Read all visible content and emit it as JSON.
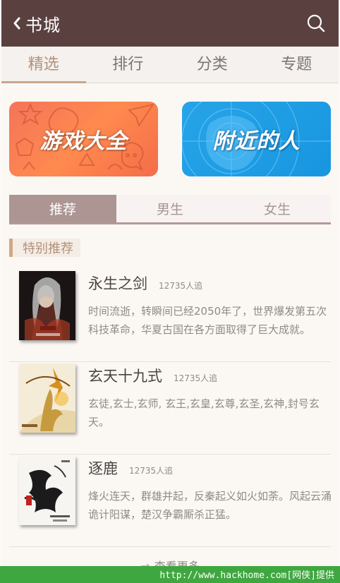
{
  "header": {
    "title": "书城",
    "back_icon": "chevron-left-icon",
    "search_icon": "search-icon"
  },
  "top_tabs": [
    {
      "label": "精选",
      "active": true
    },
    {
      "label": "排行",
      "active": false
    },
    {
      "label": "分类",
      "active": false
    },
    {
      "label": "专题",
      "active": false
    }
  ],
  "banners": [
    {
      "label": "游戏大全",
      "color": "#f4745a"
    },
    {
      "label": "附近的人",
      "color": "#1c9ae3"
    }
  ],
  "sub_tabs": [
    {
      "label": "推荐",
      "active": true
    },
    {
      "label": "男生",
      "active": false
    },
    {
      "label": "女生",
      "active": false
    }
  ],
  "section": {
    "title": "特别推荐"
  },
  "books": [
    {
      "title": "永生之剑",
      "followers": "12735人追",
      "description": "时间流逝，转瞬间已经2050年了，世界爆发第五次科技革命，华夏古国在各方面取得了巨大成就。"
    },
    {
      "title": "玄天十九式",
      "followers": "12735人追",
      "description": "玄徒,玄士,玄师, 玄王,玄皇,玄尊,玄圣,玄神,封号玄天。"
    },
    {
      "title": "逐鹿",
      "followers": "12735人追",
      "description": "烽火连天，群雄并起，反秦起义如火如荼。风起云涌诡计阳谋，楚汉争霸厮杀正猛。"
    }
  ],
  "more": {
    "label": "查看更多",
    "arrow_icon": "arrow-right-icon"
  },
  "footer": {
    "text": "http://www.hackhome.com[网侠]提供"
  }
}
